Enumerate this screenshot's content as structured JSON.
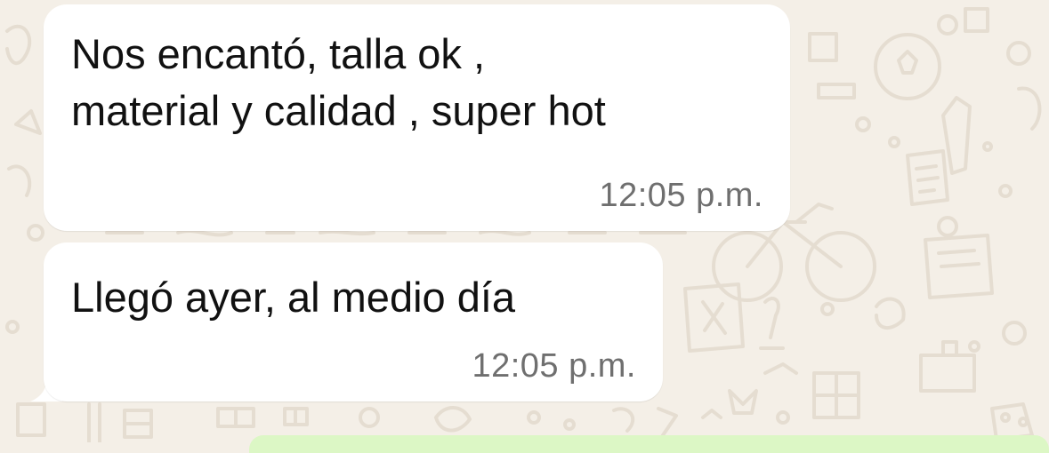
{
  "chat": {
    "messages": [
      {
        "text": "Nos encantó, talla ok ,\nmaterial y calidad , super hot",
        "time": "12:05 p.m."
      },
      {
        "text": "Llegó ayer, al medio día",
        "time": "12:05 p.m."
      }
    ]
  },
  "colors": {
    "background": "#f4efe7",
    "incoming_bubble": "#ffffff",
    "outgoing_bubble": "#dcf7c5",
    "message_text": "#111111",
    "timestamp_text": "#6f6f6f",
    "doodle_stroke": "#e5ddd1"
  },
  "icons": [
    "doodle-pattern-icon"
  ]
}
